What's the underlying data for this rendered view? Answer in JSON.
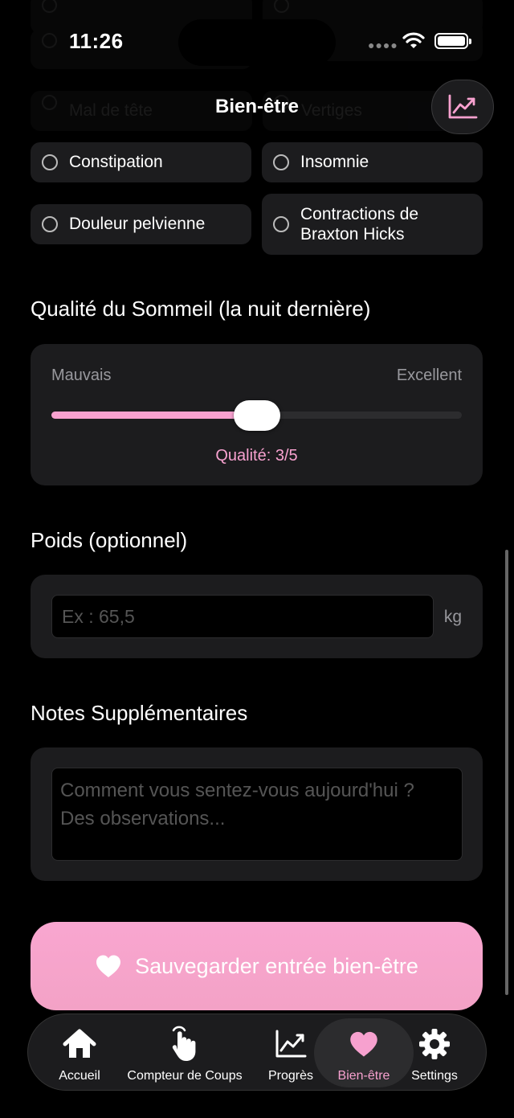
{
  "status_bar": {
    "time": "11:26"
  },
  "header": {
    "title": "Bien-être"
  },
  "faded_symptoms": [
    "Mal de tête",
    "Vertiges"
  ],
  "symptoms": [
    {
      "label": "Constipation"
    },
    {
      "label": "Insomnie"
    },
    {
      "label": "Douleur pelvienne"
    },
    {
      "label": "Contractions de Braxton Hicks"
    }
  ],
  "sleep": {
    "title": "Qualité du Sommeil (la nuit dernière)",
    "min_label": "Mauvais",
    "max_label": "Excellent",
    "value": 3,
    "max": 5,
    "value_label": "Qualité: 3/5"
  },
  "weight": {
    "title": "Poids (optionnel)",
    "placeholder": "Ex : 65,5",
    "unit": "kg"
  },
  "notes": {
    "title": "Notes Supplémentaires",
    "placeholder": "Comment vous sentez-vous aujourd'hui ? Des observations..."
  },
  "save_button": {
    "label": "Sauvegarder entrée bien-être"
  },
  "tabs": [
    {
      "label": "Accueil",
      "icon": "home-icon"
    },
    {
      "label": "Compteur de Coups",
      "icon": "tap-hand-icon"
    },
    {
      "label": "Progrès",
      "icon": "chart-icon"
    },
    {
      "label": "Bien-être",
      "icon": "heart-icon",
      "active": true
    },
    {
      "label": "Settings",
      "icon": "gear-icon"
    }
  ],
  "colors": {
    "accent": "#f7a1cf",
    "card": "#1c1c1e",
    "background": "#000000"
  }
}
